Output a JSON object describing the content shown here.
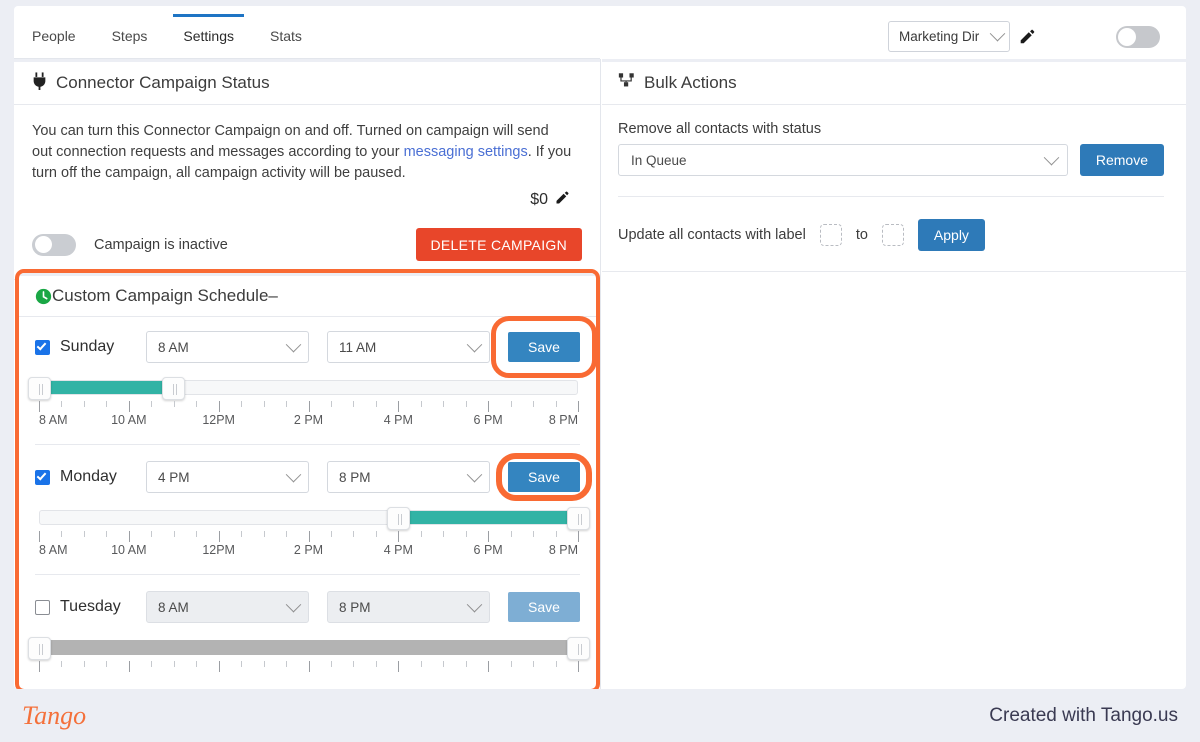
{
  "colors": {
    "accent_blue": "#2e7ab8",
    "tab_active": "#1e74c4",
    "danger_red": "#e8462a",
    "highlight_orange": "#f96a33",
    "slider_fill_teal": "#32b3a5",
    "clock_green": "#1aa745",
    "page_bg": "#eceef4"
  },
  "tabs": [
    {
      "label": "People",
      "active": false
    },
    {
      "label": "Steps",
      "active": false
    },
    {
      "label": "Settings",
      "active": true
    },
    {
      "label": "Stats",
      "active": false
    }
  ],
  "header": {
    "account_select_value": "Marketing Dir",
    "edit_icon": "edit-pencil-icon",
    "chevron_icon": "chevron-down-icon",
    "toggle_state": "off"
  },
  "connector_panel": {
    "icon": "plug-icon",
    "title": "Connector Campaign Status",
    "description_part1": "You can turn this Connector Campaign on and off. Turned on campaign will send out connection requests and messages according to your ",
    "description_link": "messaging settings",
    "description_part2": ". If you turn off the campaign, all campaign activity will be paused.",
    "amount": "$0",
    "amount_edit_icon": "edit-pencil-icon",
    "toggle_state": "off",
    "status_text": "Campaign is inactive",
    "delete_button": "DELETE CAMPAIGN"
  },
  "bulk_panel": {
    "icon": "sitemap-icon",
    "title": "Bulk Actions",
    "remove_label": "Remove all contacts with status",
    "remove_select_value": "In Queue",
    "remove_button": "Remove",
    "update_label": "Update all contacts with label",
    "update_to": "to",
    "apply_button": "Apply",
    "label_from_placeholder": "",
    "label_to_placeholder": ""
  },
  "schedule_panel": {
    "icon": "clock-icon",
    "title": "Custom Campaign Schedule",
    "collapse_icon": "minus-icon",
    "collapse_glyph": "–",
    "save_label": "Save",
    "tick_labels": [
      "8 AM",
      "10 AM",
      "12PM",
      "2 PM",
      "4 PM",
      "6 PM",
      "8 PM"
    ],
    "days": [
      {
        "name": "Sunday",
        "checked": true,
        "enabled": true,
        "start_time": "8 AM",
        "end_time": "11 AM",
        "highlighted_save": true,
        "slider_start_pct": 0,
        "slider_end_pct": 25
      },
      {
        "name": "Monday",
        "checked": true,
        "enabled": true,
        "start_time": "4 PM",
        "end_time": "8 PM",
        "highlighted_save": true,
        "slider_start_pct": 66.7,
        "slider_end_pct": 100
      },
      {
        "name": "Tuesday",
        "checked": false,
        "enabled": false,
        "start_time": "8 AM",
        "end_time": "8 PM",
        "highlighted_save": false,
        "slider_start_pct": 0,
        "slider_end_pct": 100
      }
    ]
  },
  "footer": {
    "logo_text": "Tango",
    "credit_text": "Created with Tango.us"
  }
}
